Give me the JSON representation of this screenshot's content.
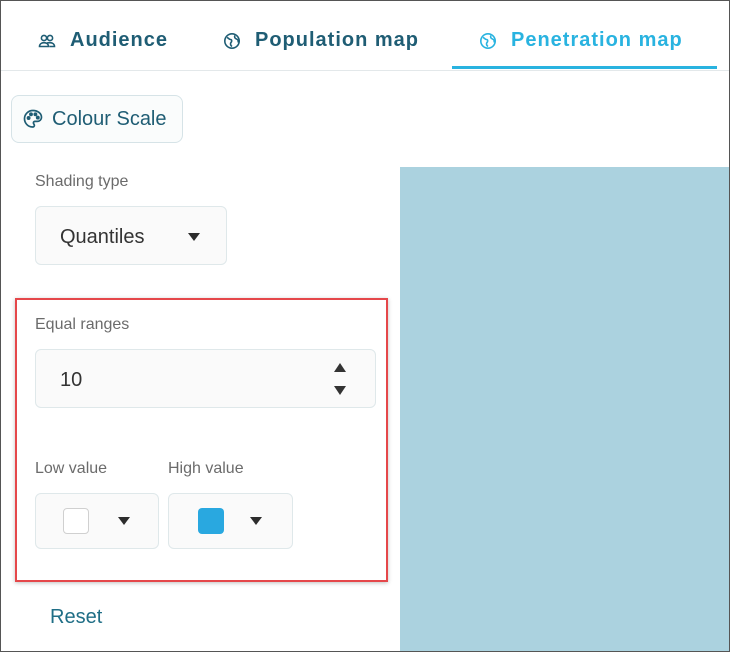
{
  "tabs": [
    {
      "label": "Audience",
      "icon": "audience-icon"
    },
    {
      "label": "Population map",
      "icon": "globe-icon"
    },
    {
      "label": "Penetration map",
      "icon": "globe-icon",
      "active": true
    }
  ],
  "colour_scale": {
    "label": "Colour Scale",
    "icon": "palette-icon"
  },
  "panel": {
    "shading_type": {
      "label": "Shading type",
      "value": "Quantiles"
    },
    "equal_ranges": {
      "label": "Equal ranges",
      "value": "10"
    },
    "low_value": {
      "label": "Low value",
      "color": "#ffffff"
    },
    "high_value": {
      "label": "High value",
      "color": "#29a8e0"
    },
    "reset_label": "Reset"
  },
  "colors": {
    "accent": "#29b3e0",
    "text_primary": "#1f5d74",
    "map_fill": "#abd2df",
    "highlight": "#e5474a"
  }
}
